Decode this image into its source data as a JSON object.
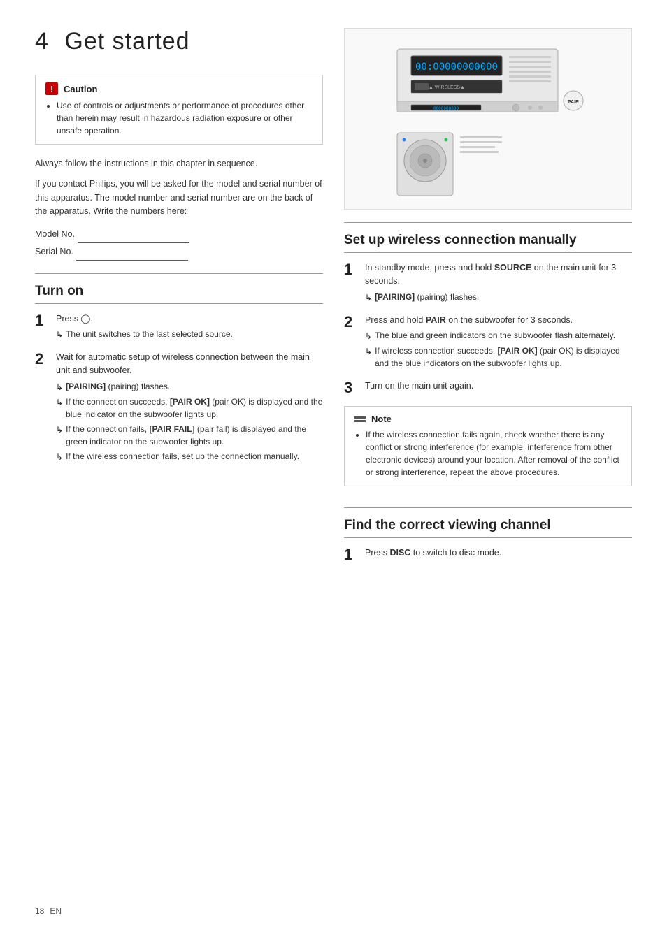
{
  "chapter": {
    "number": "4",
    "title": "Get started"
  },
  "caution": {
    "label": "Caution",
    "items": [
      "Use of controls or adjustments or performance of procedures other than herein may result in hazardous radiation exposure or other unsafe operation."
    ]
  },
  "intro": {
    "line1": "Always follow the instructions in this chapter in sequence.",
    "line2": "If you contact Philips, you will be asked for the model and serial number of this apparatus. The model number and serial number are on the back of the apparatus. Write the numbers here:",
    "model_label": "Model No.",
    "serial_label": "Serial No."
  },
  "turn_on": {
    "heading": "Turn on",
    "steps": [
      {
        "num": "1",
        "main": "Press ⒪.",
        "arrows": [
          "The unit switches to the last selected source."
        ]
      },
      {
        "num": "2",
        "main": "Wait for automatic setup of wireless connection between the main unit and subwoofer.",
        "arrows": [
          "[PAIRING] (pairing) flashes.",
          "If the connection succeeds, [PAIR OK] (pair OK) is displayed and the blue indicator on the subwoofer lights up.",
          "If the connection fails, [PAIR FAIL] (pair fail) is displayed and the green indicator on the subwoofer lights up.",
          "If the wireless connection fails, set up the connection manually."
        ],
        "bold_arrows": [
          0,
          1,
          2
        ]
      }
    ]
  },
  "wireless_setup": {
    "heading": "Set up wireless connection manually",
    "steps": [
      {
        "num": "1",
        "main": "In standby mode, press and hold SOURCE on the main unit for 3 seconds.",
        "arrows": [
          "[PAIRING] (pairing) flashes."
        ]
      },
      {
        "num": "2",
        "main": "Press and hold PAIR on the subwoofer for 3 seconds.",
        "arrows": [
          "The blue and green indicators on the subwoofer flash alternately.",
          "If wireless connection succeeds, [PAIR OK] (pair OK) is displayed and the blue indicators on the subwoofer lights up."
        ]
      },
      {
        "num": "3",
        "main": "Turn on the main unit again.",
        "arrows": []
      }
    ],
    "note": {
      "label": "Note",
      "items": [
        "If the wireless connection fails again, check whether there is any conflict or strong interference (for example, interference from other electronic devices) around your location. After removal of the conflict or strong interference, repeat the above procedures."
      ]
    }
  },
  "find_channel": {
    "heading": "Find the correct viewing channel",
    "steps": [
      {
        "num": "1",
        "main": "Press DISC to switch to disc mode.",
        "arrows": []
      }
    ]
  },
  "footer": {
    "page_num": "18",
    "lang": "EN"
  },
  "bold_tags": {
    "source": "SOURCE",
    "pairing": "[PAIRING]",
    "pair": "PAIR",
    "pair_ok": "[PAIR OK]",
    "pair_fail": "[PAIR FAIL]",
    "disc": "DISC"
  }
}
